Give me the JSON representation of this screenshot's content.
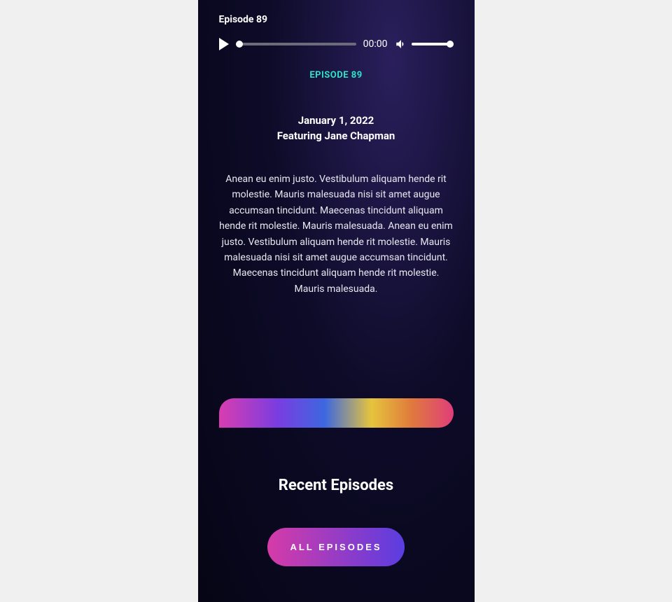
{
  "player": {
    "title": "Episode 89",
    "time": "00:00"
  },
  "episode": {
    "label": "EPISODE 89",
    "date": "January 1, 2022",
    "featuring": "Featuring Jane Chapman",
    "description": "Anean eu enim justo. Vestibulum aliquam hende rit molestie. Mauris malesuada nisi sit amet augue accumsan tincidunt. Maecenas tincidunt aliquam hende rit molestie. Mauris malesuada. Anean eu enim justo. Vestibulum aliquam hende rit molestie. Mauris malesuada nisi sit amet augue accumsan tincidunt. Maecenas tincidunt aliquam hende rit molestie. Mauris malesuada."
  },
  "recent": {
    "title": "Recent Episodes",
    "button": "ALL EPISODES"
  }
}
